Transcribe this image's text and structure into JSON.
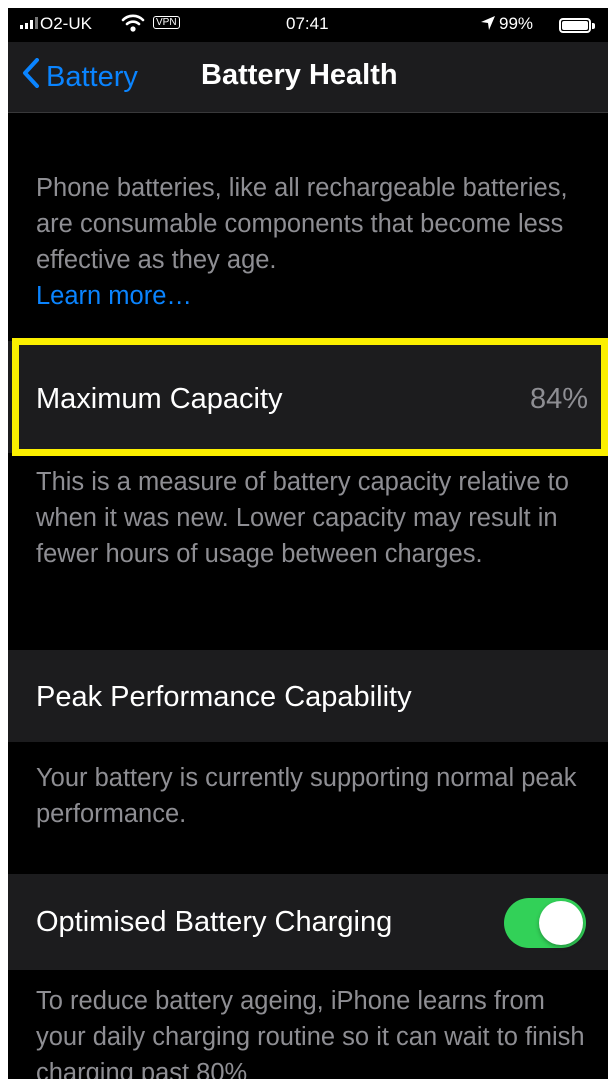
{
  "status_bar": {
    "carrier": "O2-UK",
    "vpn_badge": "VPN",
    "time": "07:41",
    "battery_percent": "99%",
    "battery_level": 0.99,
    "icons": [
      "signal-icon",
      "wifi-icon",
      "location-icon",
      "battery-icon"
    ]
  },
  "nav": {
    "back_label": "Battery",
    "title": "Battery Health"
  },
  "intro": {
    "text": "Phone batteries, like all rechargeable batteries, are consumable components that become less effective as they age.",
    "link": "Learn more…"
  },
  "maximum_capacity": {
    "label": "Maximum Capacity",
    "value": "84%",
    "description": "This is a measure of battery capacity relative to when it was new. Lower capacity may result in fewer hours of usage between charges."
  },
  "peak_performance": {
    "label": "Peak Performance Capability",
    "description": "Your battery is currently supporting normal peak performance."
  },
  "optimised_charging": {
    "label": "Optimised Battery Charging",
    "enabled": true,
    "description": "To reduce battery ageing, iPhone learns from your daily charging routine so it can wait to finish charging past 80%"
  },
  "colors": {
    "background": "#000000",
    "cell_background": "#1c1c1e",
    "accent_blue": "#0a84ff",
    "toggle_on": "#32d158",
    "highlight_yellow": "#fbef00",
    "secondary_text": "#8e8e93"
  }
}
